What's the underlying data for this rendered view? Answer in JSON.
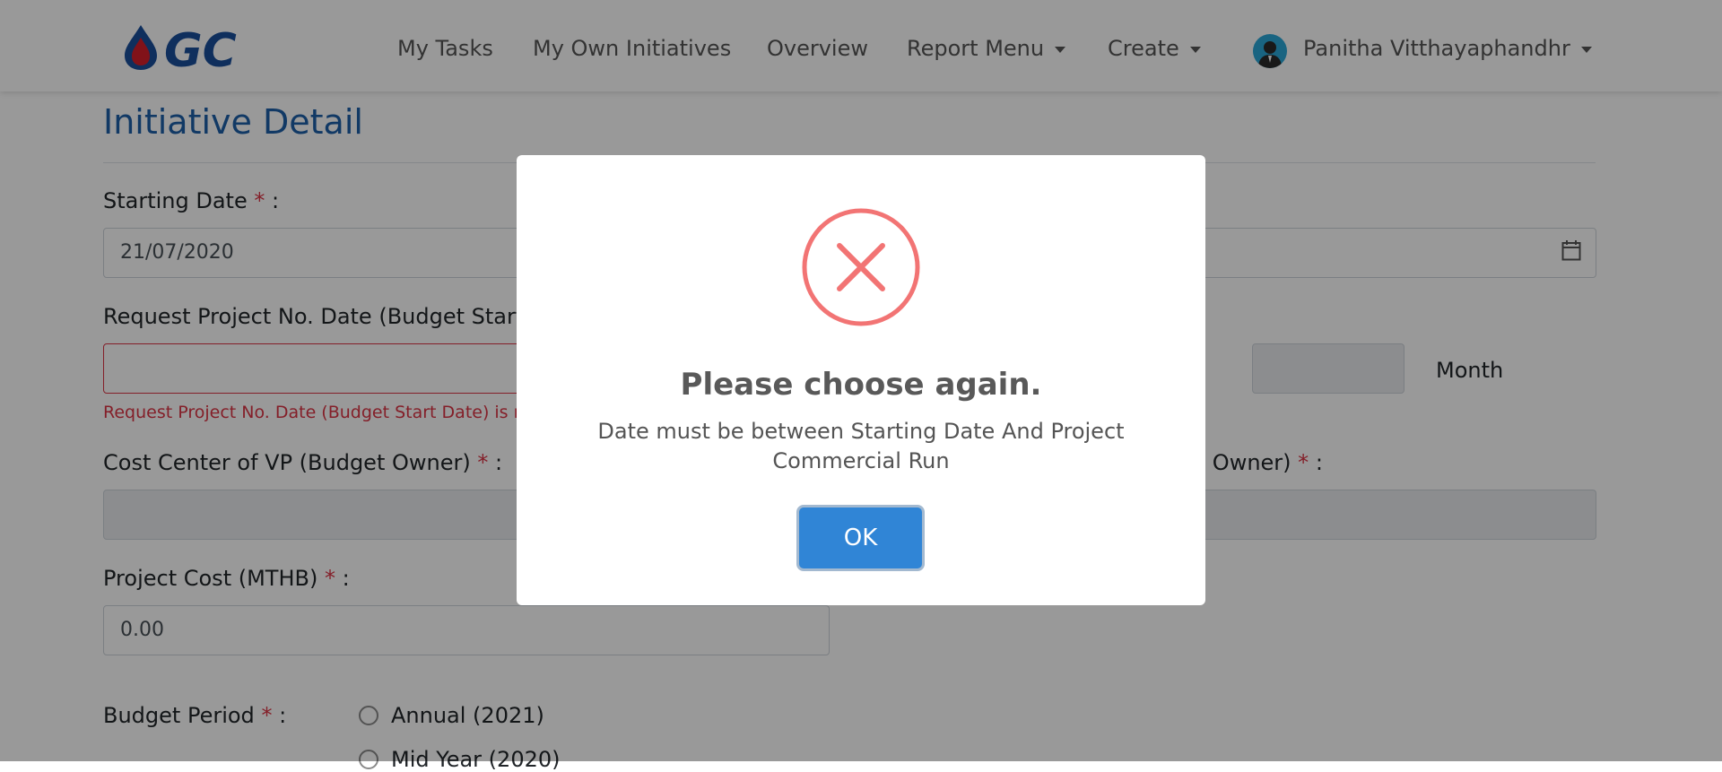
{
  "nav": {
    "my_tasks": "My Tasks",
    "my_own_initiatives": "My Own Initiatives",
    "overview": "Overview",
    "report_menu": "Report Menu",
    "create": "Create",
    "user_name": "Panitha Vitthayaphandhr",
    "logo_text": "GC"
  },
  "page": {
    "title": "Initiative Detail"
  },
  "form": {
    "starting_date_label": "Starting Date",
    "starting_date_value": "21/07/2020",
    "request_project_label": "Request Project No. Date (Budget Start D",
    "request_project_error": "Request Project No. Date (Budget Start Date) is rec",
    "month_label": "Month",
    "cost_center_label": "Cost Center of VP (Budget Owner)",
    "right_owner_label": "et Owner)",
    "project_cost_label": "Project Cost (MTHB)",
    "project_cost_value": "0.00",
    "budget_period_label": "Budget Period",
    "option_annual": "Annual (2021)",
    "option_midyear": "Mid Year (2020)",
    "required_marker": "*",
    "colon": ":"
  },
  "dialog": {
    "title": "Please choose again.",
    "message": "Date must be between Starting Date And Project Commercial Run",
    "ok_label": "OK"
  },
  "colors": {
    "brand_blue": "#1d5fa8",
    "error_red": "#f27474",
    "button_blue": "#3085d6"
  },
  "icons": [
    "gc-logo",
    "calendar-icon",
    "error-x-icon",
    "avatar"
  ]
}
